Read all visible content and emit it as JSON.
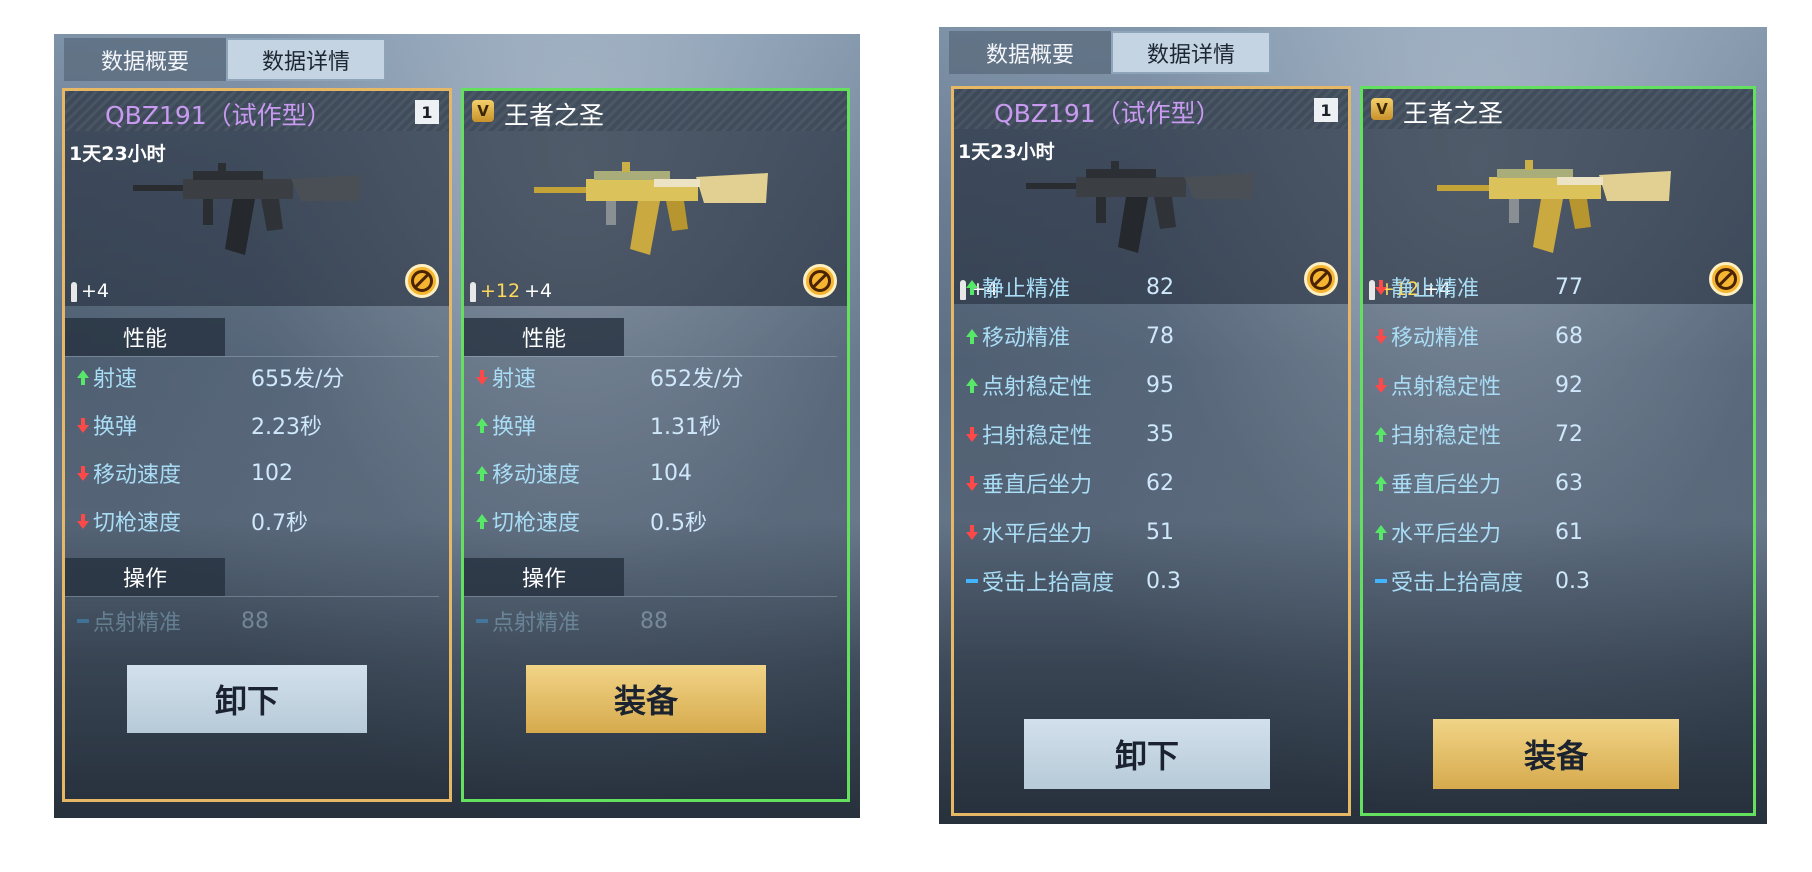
{
  "tabs": {
    "overview": "数据概要",
    "detail": "数据详情"
  },
  "current_weapon": {
    "name": "QBZ191（试作型）",
    "slot": "1",
    "timer": "1天23小时",
    "ammo_base": "+4",
    "gun_icon": "assault-rifle-grey"
  },
  "new_weapon": {
    "badge": "V",
    "name": "王者之圣",
    "ammo_bonus": "+12",
    "ammo_base": "+4",
    "gun_icon": "assault-rifle-gold"
  },
  "sections": {
    "performance": "性能",
    "operation": "操作"
  },
  "left_screenshot": {
    "current": [
      {
        "label": "射速",
        "value": "655发/分",
        "trend": "up"
      },
      {
        "label": "换弹",
        "value": "2.23秒",
        "trend": "down"
      },
      {
        "label": "移动速度",
        "value": "102",
        "trend": "down"
      },
      {
        "label": "切枪速度",
        "value": "0.7秒",
        "trend": "down"
      }
    ],
    "new": [
      {
        "label": "射速",
        "value": "652发/分",
        "trend": "down"
      },
      {
        "label": "换弹",
        "value": "1.31秒",
        "trend": "up"
      },
      {
        "label": "移动速度",
        "value": "104",
        "trend": "up"
      },
      {
        "label": "切枪速度",
        "value": "0.5秒",
        "trend": "up"
      }
    ],
    "partial_row": {
      "label": "点射精准",
      "value": "88"
    }
  },
  "right_screenshot": {
    "current": [
      {
        "label": "静止精准",
        "value": "82",
        "trend": "up"
      },
      {
        "label": "移动精准",
        "value": "78",
        "trend": "up"
      },
      {
        "label": "点射稳定性",
        "value": "95",
        "trend": "up"
      },
      {
        "label": "扫射稳定性",
        "value": "35",
        "trend": "down"
      },
      {
        "label": "垂直后坐力",
        "value": "62",
        "trend": "down"
      },
      {
        "label": "水平后坐力",
        "value": "51",
        "trend": "down"
      },
      {
        "label": "受击上抬高度",
        "value": "0.3",
        "trend": "equal"
      }
    ],
    "new": [
      {
        "label": "静止精准",
        "value": "77",
        "trend": "down"
      },
      {
        "label": "移动精准",
        "value": "68",
        "trend": "down"
      },
      {
        "label": "点射稳定性",
        "value": "92",
        "trend": "down"
      },
      {
        "label": "扫射稳定性",
        "value": "72",
        "trend": "up"
      },
      {
        "label": "垂直后坐力",
        "value": "63",
        "trend": "up"
      },
      {
        "label": "水平后坐力",
        "value": "61",
        "trend": "up"
      },
      {
        "label": "受击上抬高度",
        "value": "0.3",
        "trend": "equal"
      }
    ]
  },
  "buttons": {
    "unload": "卸下",
    "equip": "装备"
  },
  "colors": {
    "current_border": "#e6b765",
    "new_border": "#63e05e",
    "up": "#58e868",
    "down": "#ff4848",
    "equal": "#43b4ff",
    "rarity_purple": "#c89af0"
  }
}
